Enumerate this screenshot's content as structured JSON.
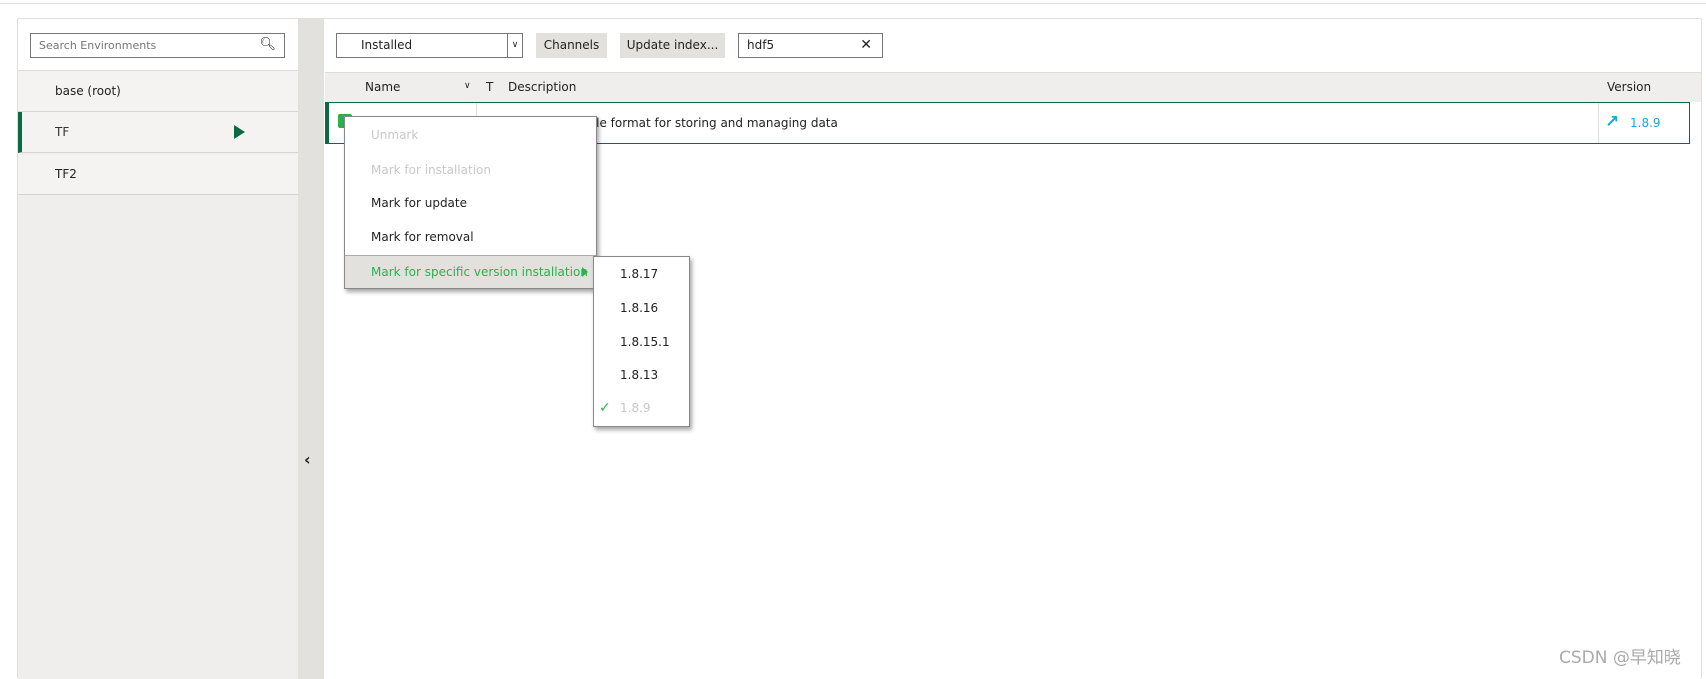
{
  "sidebar": {
    "search_placeholder": "Search Environments",
    "environments": [
      {
        "label": "base (root)"
      },
      {
        "label": "TF",
        "active": true
      },
      {
        "label": "TF2"
      }
    ]
  },
  "toolbar": {
    "filter_select": "Installed",
    "channels_label": "Channels",
    "update_index_label": "Update index...",
    "search_value": "hdf5"
  },
  "table": {
    "headers": {
      "name": "Name",
      "type": "T",
      "description": "Description",
      "version": "Version"
    },
    "rows": [
      {
        "description": "del, library, and file format for storing and managing data",
        "version": "1.8.9",
        "status": "update-available"
      }
    ]
  },
  "context_menu": {
    "items": [
      {
        "label": "Unmark",
        "enabled": false
      },
      {
        "label": "Mark for installation",
        "enabled": false
      },
      {
        "label": "Mark for update",
        "enabled": true
      },
      {
        "label": "Mark for removal",
        "enabled": true
      },
      {
        "label": "Mark for specific version installation",
        "enabled": true,
        "highlighted": true
      }
    ]
  },
  "version_submenu": {
    "items": [
      {
        "label": "1.8.17"
      },
      {
        "label": "1.8.16"
      },
      {
        "label": "1.8.15.1"
      },
      {
        "label": "1.8.13"
      },
      {
        "label": "1.8.9",
        "current": true
      }
    ]
  },
  "colors": {
    "accent": "#0b6a44",
    "green": "#2bb24c",
    "update_blue": "#1aa6e0"
  },
  "watermark": "CSDN @早知晓"
}
